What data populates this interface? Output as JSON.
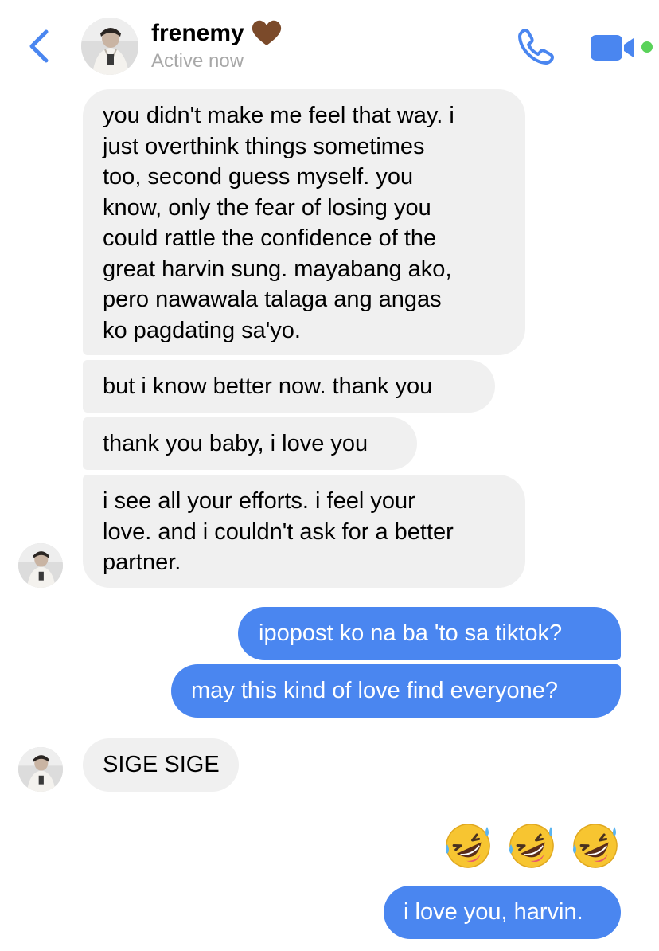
{
  "header": {
    "contact_name": "frenemy",
    "status": "Active now",
    "icons": [
      "chevron-left-icon",
      "brown-heart-icon",
      "phone-icon",
      "video-camera-icon"
    ],
    "accent_color": "#4a86f0",
    "active_dot_color": "#5ad25a"
  },
  "messages": [
    {
      "from": "contact",
      "text": "you didn't make me feel that way. i\njust overthink things sometimes\ntoo, second guess myself. you\nknow, only the fear of losing you\ncould rattle the confidence of the\ngreat harvin sung. mayabang ako,\npero nawawala talaga ang angas\nko pagdating sa'yo."
    },
    {
      "from": "contact",
      "text": "but i know better now. thank you"
    },
    {
      "from": "contact",
      "text": "thank you baby, i love you"
    },
    {
      "from": "contact",
      "text": "i see all your efforts. i feel your\nlove. and i couldn't ask for a better\npartner."
    },
    {
      "from": "me",
      "text": "ipopost ko na ba 'to sa tiktok?"
    },
    {
      "from": "me",
      "text": "may this kind of love find everyone?"
    },
    {
      "from": "contact",
      "text": "SIGE SIGE"
    },
    {
      "from": "me",
      "emoji": [
        "rofl-emoji",
        "rofl-emoji",
        "rofl-emoji"
      ]
    },
    {
      "from": "me",
      "text": "i love you, harvin."
    }
  ],
  "colors": {
    "incoming_bubble": "#f0f0f0",
    "outgoing_bubble": "#4a86f0",
    "status_text": "#a8a8a8"
  }
}
